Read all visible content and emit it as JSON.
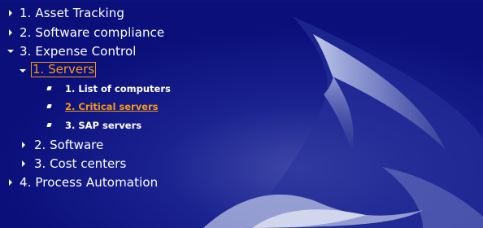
{
  "tree": {
    "asset_tracking": "1. Asset Tracking",
    "software_compliance": "2. Software compliance",
    "expense_control": "3. Expense Control",
    "servers": "1. Servers",
    "list_of_computers": "1. List of computers",
    "critical_servers": "2. Critical servers",
    "sap_servers": "3. SAP servers",
    "software": "2. Software",
    "cost_centers": "3. Cost centers",
    "process_automation": "4. Process Automation"
  },
  "colors": {
    "background": "#0a0f7a",
    "text": "#ffffff",
    "accent": "#f39a1a"
  },
  "icons": {
    "collapsed": "triangle-right-icon",
    "expanded": "triangle-down-icon",
    "leaf": "bullet-icon"
  }
}
